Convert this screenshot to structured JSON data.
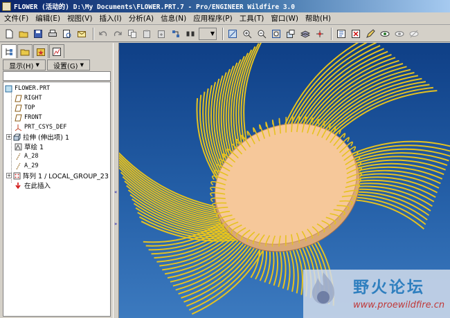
{
  "window": {
    "title": "FLOWER (活动的) D:\\My Documents\\FLOWER.PRT.7 - Pro/ENGINEER Wildfire 3.0"
  },
  "menubar": [
    {
      "label": "文件(F)"
    },
    {
      "label": "编辑(E)"
    },
    {
      "label": "视图(V)"
    },
    {
      "label": "插入(I)"
    },
    {
      "label": "分析(A)"
    },
    {
      "label": "信息(N)"
    },
    {
      "label": "应用程序(P)"
    },
    {
      "label": "工具(T)"
    },
    {
      "label": "窗口(W)"
    },
    {
      "label": "帮助(H)"
    }
  ],
  "toolbar": {
    "icons": [
      "new-file-icon",
      "open-file-icon",
      "save-icon",
      "print-icon",
      "print-preview-icon",
      "email-icon",
      "undo-icon",
      "redo-icon",
      "copy-icon",
      "paste-icon",
      "paste-special-icon",
      "regenerate-icon",
      "find-icon",
      "select-icon",
      "view-orient-icon",
      "zoom-in-icon",
      "zoom-out-icon",
      "refit-icon",
      "view-manager-icon",
      "layers-icon",
      "spin-center-icon",
      "datum-display-icon",
      "close-window-icon",
      "sketch-icon",
      "hide-icon",
      "shade-icon"
    ]
  },
  "model_tree": {
    "show_menu": "显示(H)",
    "settings_menu": "设置(G)",
    "items": [
      {
        "label": "FLOWER.PRT",
        "icon": "part-icon",
        "indent": 0,
        "expander": ""
      },
      {
        "label": "RIGHT",
        "icon": "datum-plane-icon",
        "indent": 1,
        "expander": ""
      },
      {
        "label": "TOP",
        "icon": "datum-plane-icon",
        "indent": 1,
        "expander": ""
      },
      {
        "label": "FRONT",
        "icon": "datum-plane-icon",
        "indent": 1,
        "expander": ""
      },
      {
        "label": "PRT_CSYS_DEF",
        "icon": "csys-icon",
        "indent": 1,
        "expander": ""
      },
      {
        "label": "拉伸 (伸出项) 1",
        "icon": "extrude-icon",
        "indent": 1,
        "expander": "+"
      },
      {
        "label": "草绘 1",
        "icon": "sketch-feature-icon",
        "indent": 1,
        "expander": ""
      },
      {
        "label": "A_28",
        "icon": "datum-axis-icon",
        "indent": 1,
        "expander": ""
      },
      {
        "label": "A_29",
        "icon": "datum-axis-icon",
        "indent": 1,
        "expander": ""
      },
      {
        "label": "阵列 1 / LOCAL_GROUP_23",
        "icon": "pattern-icon",
        "indent": 1,
        "expander": "+"
      },
      {
        "label": "在此插入",
        "icon": "insert-here-icon",
        "indent": 1,
        "expander": ""
      }
    ]
  },
  "watermark": {
    "name": "野火论坛",
    "url": "www.proewildfire.cn"
  },
  "colors": {
    "viewport_top": "#0f3f86",
    "viewport_bottom": "#3c7abf",
    "disk": "#f6c89a",
    "curves": "#e6c21f"
  }
}
